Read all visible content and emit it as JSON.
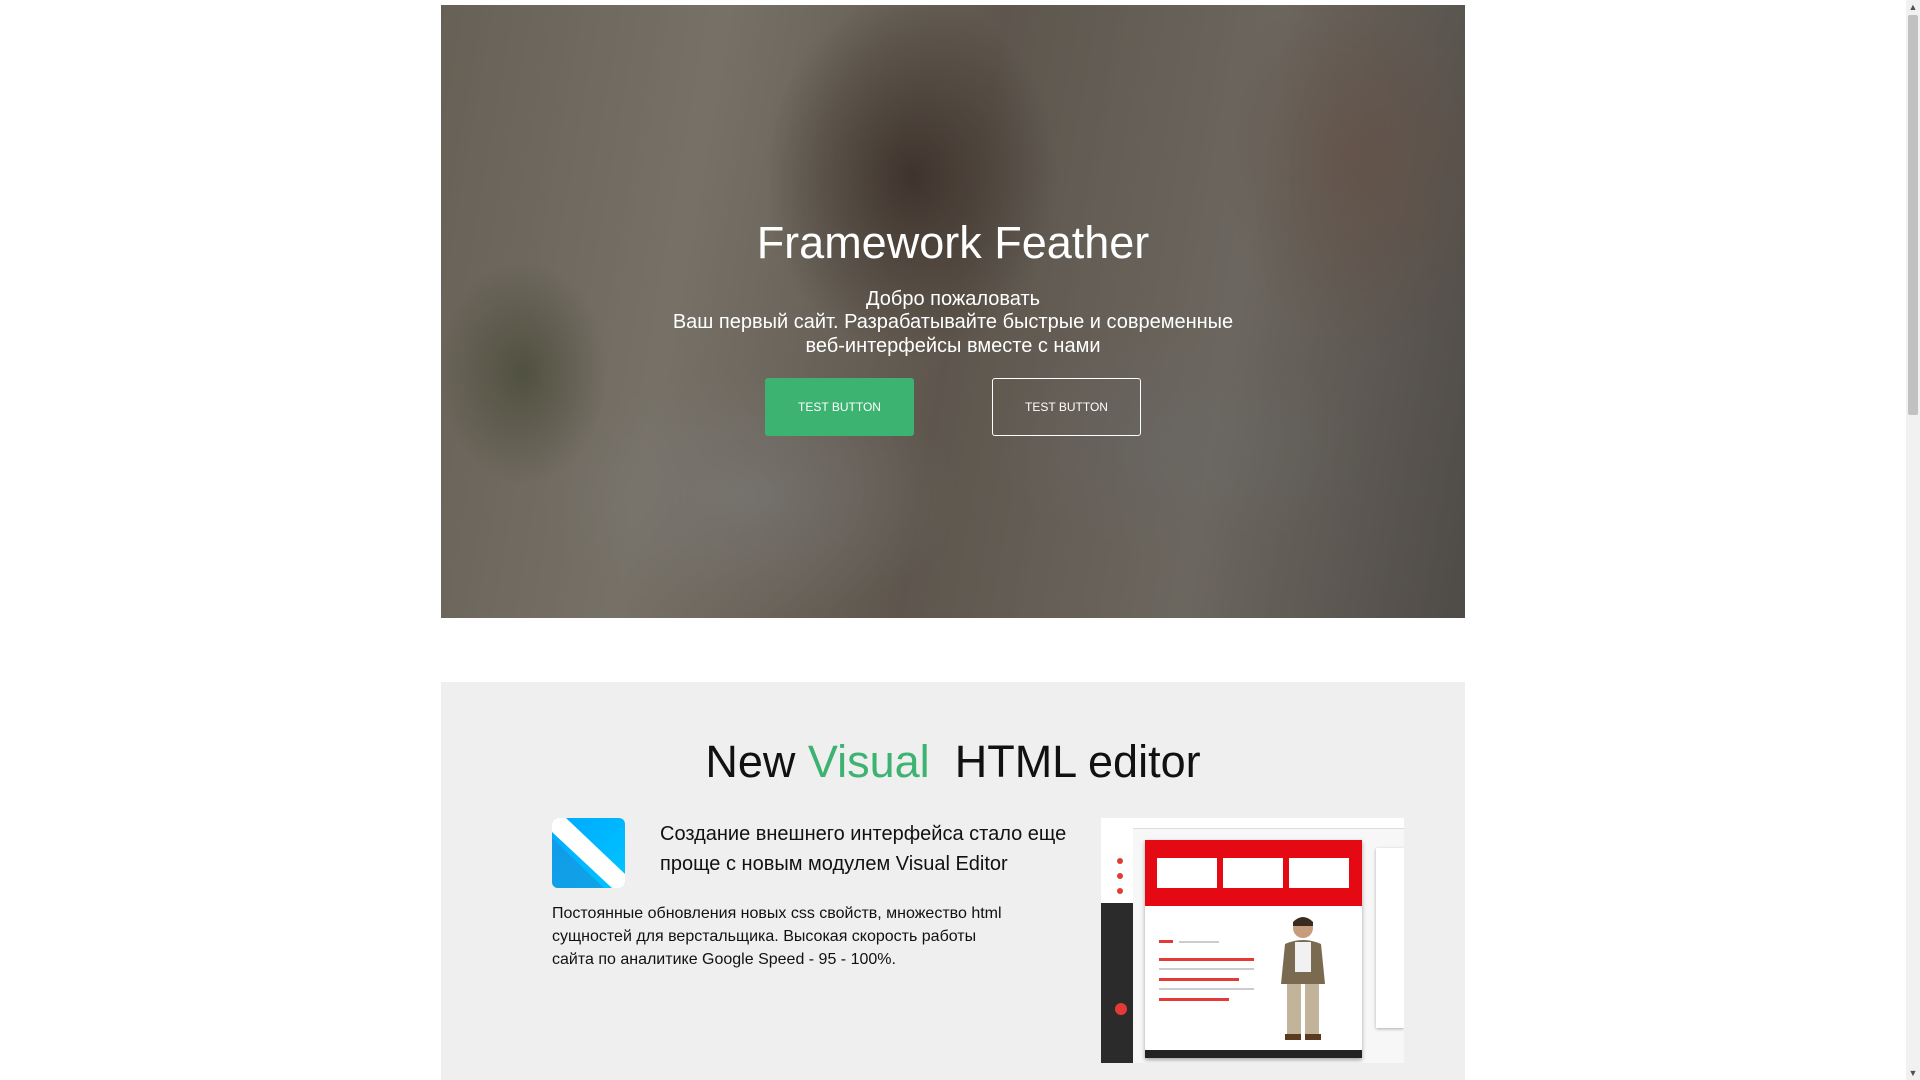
{
  "hero": {
    "title": "Framework Feather",
    "subtitle": "Добро пожаловать",
    "text": "Ваш первый сайт. Разрабатывайте быстрые и современные веб-интерфейсы вместе с нами",
    "primary_button": "TEST BUTTON",
    "secondary_button": "TEST BUTTON",
    "accent_color": "#3cb371"
  },
  "editor": {
    "title_part1": "New",
    "title_accent": "Visual",
    "title_part2": "HTML editor",
    "lead": "Создание внешнего интерфейса стало еще проще с новым модулем Visual Editor",
    "description": "Постоянные обновления новых css свойств, множество html сущностей для верстальщика. Высокая скорость работы сайта по аналитике Google Speed - 95 - 100%.",
    "logo_icon": "visual-editor-logo-icon",
    "preview_image": "visual-editor-screenshot"
  }
}
